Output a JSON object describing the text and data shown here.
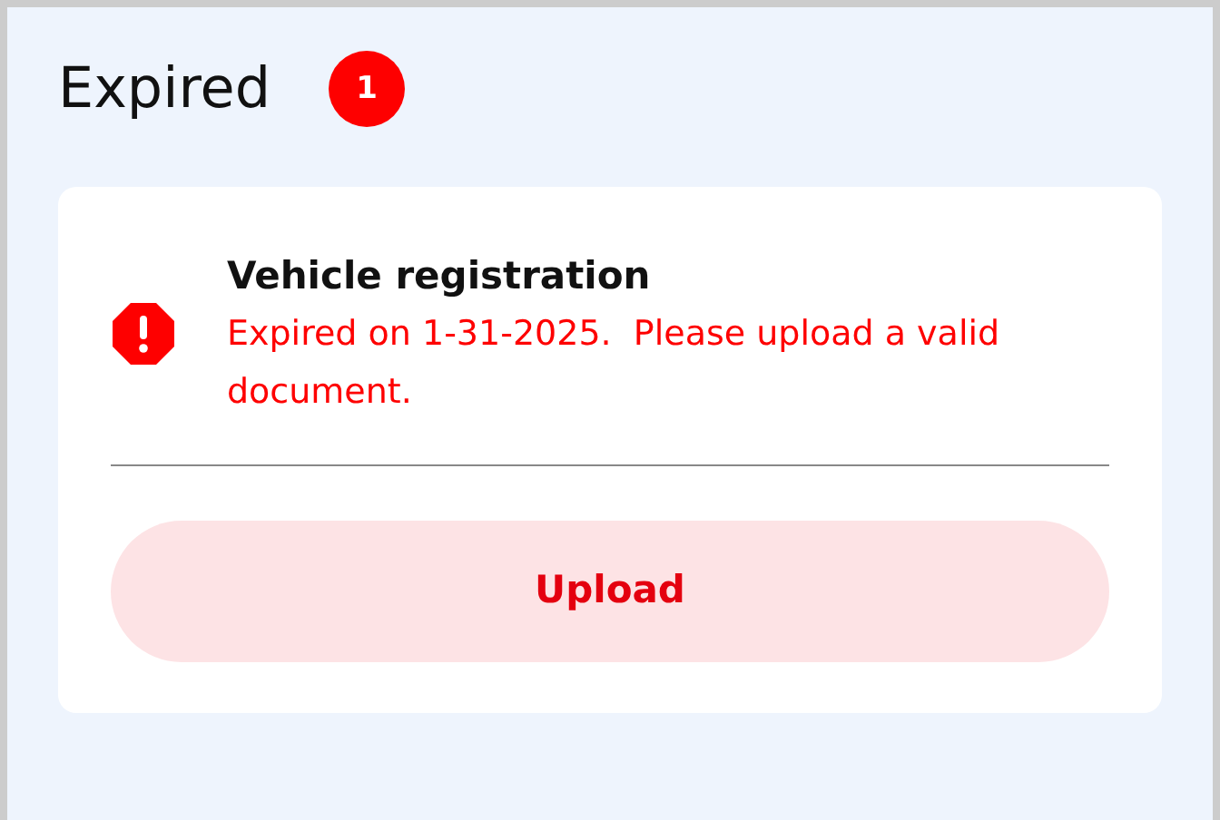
{
  "section": {
    "title": "Expired",
    "count": "1"
  },
  "documents": [
    {
      "name": "Vehicle registration",
      "expired": true,
      "message": "Expired on 1-31-2025.  Please upload a valid document.",
      "action": "Upload"
    }
  ]
}
